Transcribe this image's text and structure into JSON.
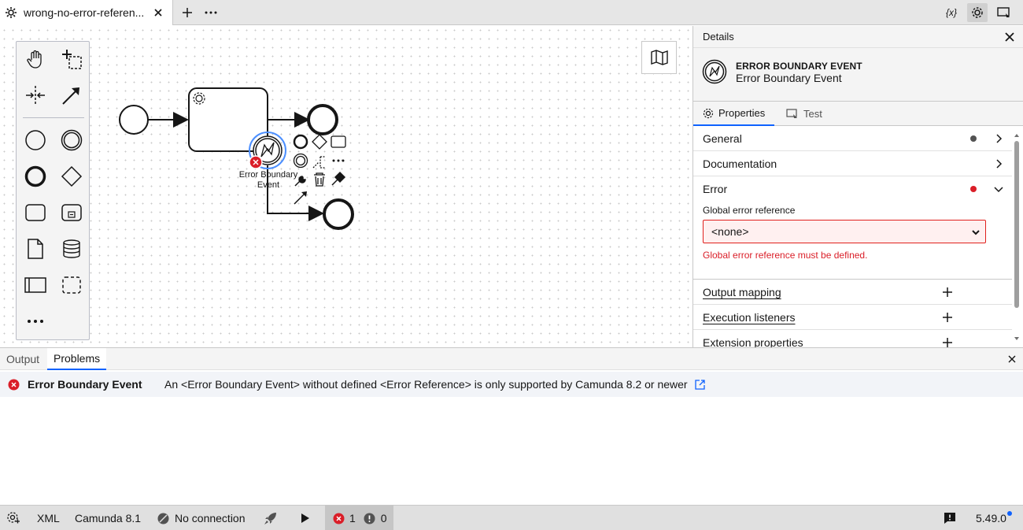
{
  "tabbar": {
    "tab_title": "wrong-no-error-referen...",
    "variables_label": "{x}"
  },
  "canvas": {
    "boundary_label_line1": "Error Boundary",
    "boundary_label_line2": "Event"
  },
  "details": {
    "title": "Details",
    "element_type": "ERROR BOUNDARY EVENT",
    "element_name": "Error Boundary Event",
    "tabs": [
      {
        "label": "Properties"
      },
      {
        "label": "Test"
      }
    ],
    "groups": {
      "general": "General",
      "documentation": "Documentation",
      "error": "Error",
      "output_mapping": "Output mapping",
      "execution_listeners": "Execution listeners",
      "extension_properties": "Extension properties"
    },
    "error_entry": {
      "label": "Global error reference",
      "value": "<none>",
      "error_message": "Global error reference must be defined."
    },
    "colors": {
      "dot_gray": "#525252",
      "dot_error": "#da1e28"
    }
  },
  "bottom": {
    "tabs": [
      {
        "label": "Output"
      },
      {
        "label": "Problems"
      }
    ],
    "problem": {
      "element": "Error Boundary Event",
      "message": "An <Error Boundary Event> without defined <Error Reference> is only supported by Camunda 8.2 or newer"
    }
  },
  "status": {
    "xml": "XML",
    "engine": "Camunda 8.1",
    "connection": "No connection",
    "error_count": "1",
    "warning_count": "0",
    "version": "5.49.0"
  },
  "colors": {
    "accent": "#0f62fe",
    "error": "#da1e28",
    "selection": "#4d90ff"
  }
}
